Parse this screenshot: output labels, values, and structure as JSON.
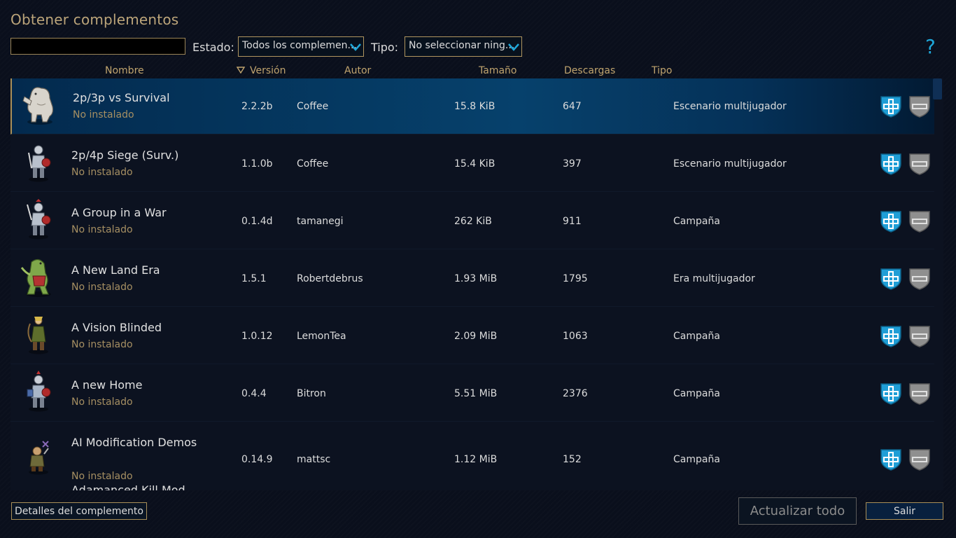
{
  "window": {
    "title": "Obtener complementos"
  },
  "filters": {
    "search_value": "",
    "estado_label": "Estado:",
    "estado_value": "Todos los complemen...",
    "tipo_label": "Tipo:",
    "tipo_value": "No seleccionar ning...",
    "help": "?"
  },
  "columns": [
    "Nombre",
    "Versión",
    "Autor",
    "Tamaño",
    "Descargas",
    "Tipo"
  ],
  "addons": [
    {
      "name": "2p/3p vs Survival",
      "status": "No instalado",
      "version": "2.2.2b",
      "author": "Coffee",
      "size": "15.8 KiB",
      "downloads": "647",
      "type": "Escenario multijugador",
      "icon": "yeti-unit-icon"
    },
    {
      "name": "2p/4p Siege (Surv.)",
      "status": "No instalado",
      "version": "1.1.0b",
      "author": "Coffee",
      "size": "15.4 KiB",
      "downloads": "397",
      "type": "Escenario multijugador",
      "icon": "knight-unit-icon"
    },
    {
      "name": "A Group in a War",
      "status": "No instalado",
      "version": "0.1.4d",
      "author": "tamanegi",
      "size": "262 KiB",
      "downloads": "911",
      "type": "Campaña",
      "icon": "knight-unit-icon"
    },
    {
      "name": "A New Land Era",
      "status": "No instalado",
      "version": "1.5.1",
      "author": "Robertdebrus",
      "size": "1.93 MiB",
      "downloads": "1795",
      "type": "Era multijugador",
      "icon": "lizard-unit-icon"
    },
    {
      "name": "A Vision Blinded",
      "status": "No instalado",
      "version": "1.0.12",
      "author": "LemonTea",
      "size": "2.09 MiB",
      "downloads": "1063",
      "type": "Campaña",
      "icon": "elf-unit-icon"
    },
    {
      "name": "A new Home",
      "status": "No instalado",
      "version": "0.4.4",
      "author": "Bitron",
      "size": "5.51 MiB",
      "downloads": "2376",
      "type": "Campaña",
      "icon": "knight-unit-icon"
    },
    {
      "name": "AI Modification Demos",
      "status": "No instalado",
      "version": "0.14.9",
      "author": "mattsc",
      "size": "1.12 MiB",
      "downloads": "152",
      "type": "Campaña",
      "icon": "dwarf-unit-icon"
    }
  ],
  "partial_row_name": "Adamanced Kill Mod",
  "footer": {
    "details_label": "Detalles del complemento",
    "update_all_label": "Actualizar todo",
    "exit_label": "Salir"
  },
  "colors": {
    "accent_blue": "#1ea7d9",
    "gold_text": "#bca57a",
    "selected_row": "#06416c",
    "background": "#0a0f1c"
  }
}
